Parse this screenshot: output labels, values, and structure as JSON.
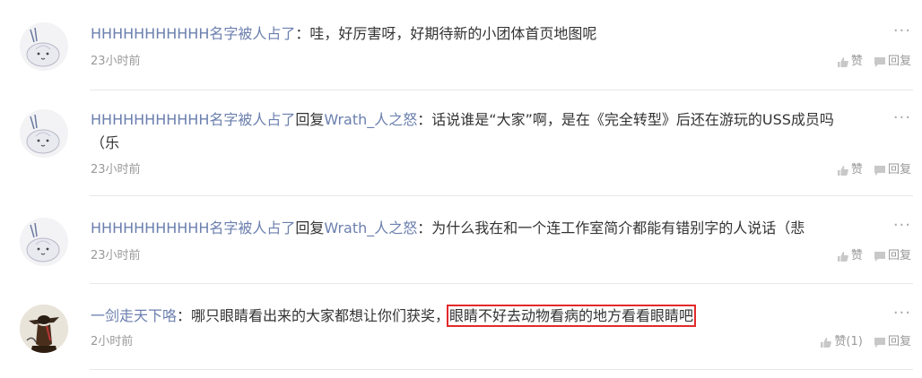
{
  "comments": [
    {
      "user": "HHHHHHHHHHH名字被人占了",
      "reply_word": "",
      "target": "",
      "colon": "：",
      "text": "哇，好厉害呀，好期待新的小团体首页地图呢",
      "text_cont": "",
      "time": "23小时前",
      "like": "赞",
      "reply": "回复",
      "avatar_icon": "garlic-avatar"
    },
    {
      "user": "HHHHHHHHHHH名字被人占了",
      "reply_word": "回复",
      "target": "Wrath_人之怒",
      "colon": "：",
      "text": "话说谁是“大家”啊，是在《完全转型》后还在游玩的USS成员吗",
      "text_cont": "（乐",
      "time": "23小时前",
      "like": "赞",
      "reply": "回复",
      "avatar_icon": "garlic-avatar"
    },
    {
      "user": "HHHHHHHHHHH名字被人占了",
      "reply_word": "回复",
      "target": "Wrath_人之怒",
      "colon": "：",
      "text": "为什么我在和一个连工作室简介都能有错别字的人说话（悲",
      "text_cont": "",
      "time": "23小时前",
      "like": "赞",
      "reply": "回复",
      "avatar_icon": "garlic-avatar"
    },
    {
      "user": "一剑走天下咯",
      "reply_word": "",
      "target": "",
      "colon": "：",
      "text": "哪只眼睛看出来的大家都想让你们获奖，",
      "highlight": "眼睛不好去动物看病的地方看看眼睛吧",
      "text_cont": "",
      "time": "2小时前",
      "like": "赞(1)",
      "reply": "回复",
      "avatar_icon": "swordsman-avatar"
    }
  ],
  "more_glyph": "···",
  "colors": {
    "username": "#6b7fae",
    "highlight_border": "#e32a2a",
    "meta": "#999999"
  }
}
